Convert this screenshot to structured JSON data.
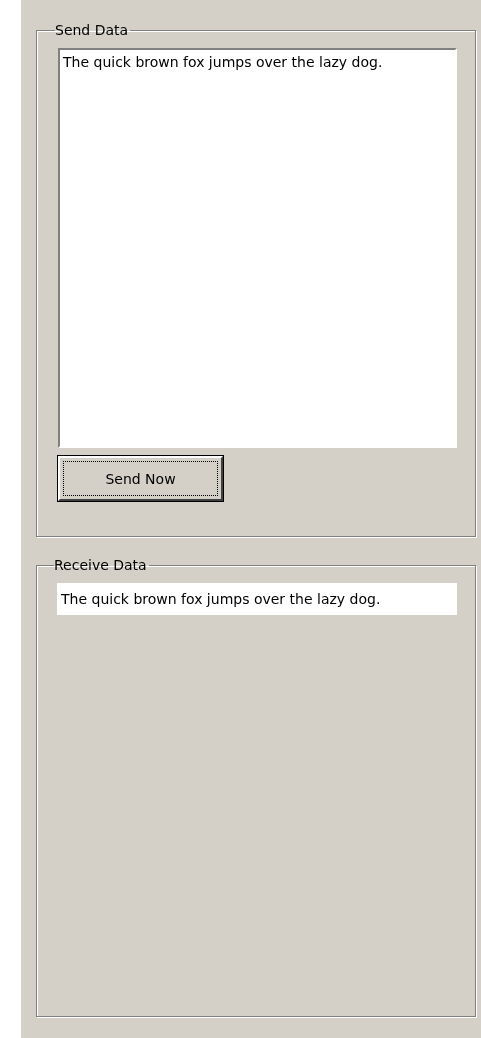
{
  "send_group": {
    "title": "Send Data",
    "text": "The quick brown fox jumps over the lazy dog.",
    "button": {
      "label": "Send Now",
      "focused": true
    }
  },
  "receive_group": {
    "title": "Receive Data",
    "text": "The quick brown fox jumps over the lazy dog."
  }
}
